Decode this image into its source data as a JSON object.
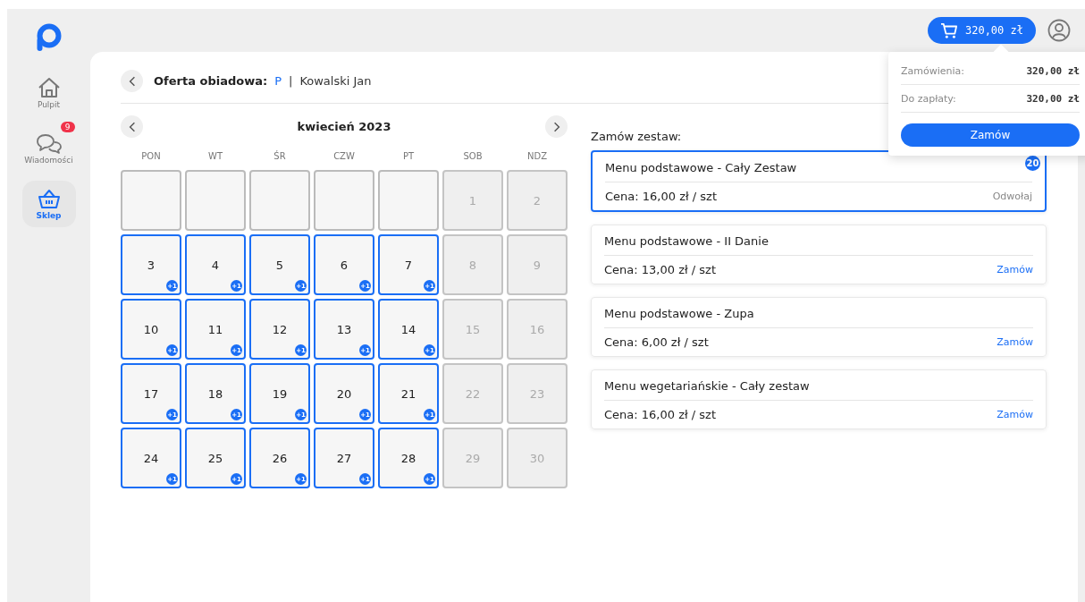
{
  "sidebar": {
    "items": [
      {
        "label": "Pulpit",
        "selected": false
      },
      {
        "label": "Wiadomości",
        "selected": false,
        "badge": "9"
      },
      {
        "label": "Sklep",
        "selected": true
      }
    ]
  },
  "topbar": {
    "cart_total": "320,00 zł"
  },
  "cart_popup": {
    "rows": [
      {
        "label": "Zamówienia:",
        "value": "320,00 zł"
      },
      {
        "label": "Do zapłaty:",
        "value": "320,00 zł"
      }
    ],
    "button": "Zamów"
  },
  "header": {
    "title": "Oferta obiadowa:",
    "code": "P",
    "separator": "|",
    "name": "Kowalski Jan"
  },
  "calendar": {
    "month": "kwiecień 2023",
    "weekdays": [
      "PON",
      "WT",
      "ŚR",
      "CZW",
      "PT",
      "SOB",
      "NDZ"
    ],
    "days": [
      {
        "kind": "blank"
      },
      {
        "kind": "blank"
      },
      {
        "kind": "blank"
      },
      {
        "kind": "blank"
      },
      {
        "kind": "blank"
      },
      {
        "kind": "weekend",
        "label": "1"
      },
      {
        "kind": "weekend",
        "label": "2"
      },
      {
        "kind": "order",
        "label": "3",
        "badge": "+1"
      },
      {
        "kind": "order",
        "label": "4",
        "badge": "+1"
      },
      {
        "kind": "order",
        "label": "5",
        "badge": "+1"
      },
      {
        "kind": "order",
        "label": "6",
        "badge": "+1"
      },
      {
        "kind": "order",
        "label": "7",
        "badge": "+1"
      },
      {
        "kind": "weekend",
        "label": "8"
      },
      {
        "kind": "weekend",
        "label": "9"
      },
      {
        "kind": "order",
        "label": "10",
        "badge": "+1"
      },
      {
        "kind": "order",
        "label": "11",
        "badge": "+1"
      },
      {
        "kind": "order",
        "label": "12",
        "badge": "+1"
      },
      {
        "kind": "order",
        "label": "13",
        "badge": "+1"
      },
      {
        "kind": "order",
        "label": "14",
        "badge": "+1"
      },
      {
        "kind": "weekend",
        "label": "15"
      },
      {
        "kind": "weekend",
        "label": "16"
      },
      {
        "kind": "order",
        "label": "17",
        "badge": "+1"
      },
      {
        "kind": "order",
        "label": "18",
        "badge": "+1"
      },
      {
        "kind": "order",
        "label": "19",
        "badge": "+1"
      },
      {
        "kind": "order",
        "label": "20",
        "badge": "+1"
      },
      {
        "kind": "order",
        "label": "21",
        "badge": "+1"
      },
      {
        "kind": "weekend",
        "label": "22"
      },
      {
        "kind": "weekend",
        "label": "23"
      },
      {
        "kind": "order",
        "label": "24",
        "badge": "+1"
      },
      {
        "kind": "order",
        "label": "25",
        "badge": "+1"
      },
      {
        "kind": "order",
        "label": "26",
        "badge": "+1"
      },
      {
        "kind": "order",
        "label": "27",
        "badge": "+1"
      },
      {
        "kind": "order",
        "label": "28",
        "badge": "+1"
      },
      {
        "kind": "weekend",
        "label": "29"
      },
      {
        "kind": "weekend",
        "label": "30"
      }
    ]
  },
  "offers": {
    "title": "Zamów zestaw:",
    "items": [
      {
        "name": "Menu podstawowe - Cały Zestaw",
        "price": "Cena: 16,00 zł / szt",
        "action": "Odwołaj",
        "selected": true,
        "badge": "20"
      },
      {
        "name": "Menu podstawowe - II Danie",
        "price": "Cena: 13,00 zł / szt",
        "action": "Zamów",
        "selected": false
      },
      {
        "name": "Menu podstawowe - Zupa",
        "price": "Cena: 6,00 zł / szt",
        "action": "Zamów",
        "selected": false
      },
      {
        "name": "Menu wegetariańskie - Cały zestaw",
        "price": "Cena: 16,00 zł / szt",
        "action": "Zamów",
        "selected": false
      }
    ]
  }
}
